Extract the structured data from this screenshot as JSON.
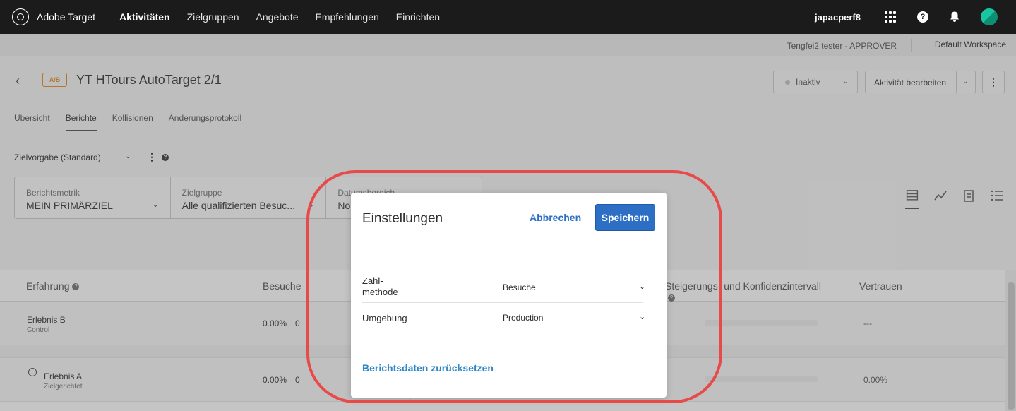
{
  "app": {
    "brand": "Adobe Target",
    "nav": [
      "Aktivitäten",
      "Zielgruppen",
      "Angebote",
      "Empfehlungen",
      "Einrichten"
    ],
    "active_nav": "Aktivitäten",
    "user": "japacperf8"
  },
  "subheader": {
    "approver": "Tengfei2 tester - APPROVER",
    "workspace": "Default Workspace"
  },
  "activity": {
    "type_badge": "A/B",
    "title": "YT HTours AutoTarget 2/1",
    "status": "Inaktiv",
    "edit_label": "Aktivität bearbeiten"
  },
  "tabs": [
    "Übersicht",
    "Berichte",
    "Kollisionen",
    "Änderungsprotokoll"
  ],
  "active_tab": "Berichte",
  "goal": {
    "label": "Zielvorgabe (Standard)"
  },
  "filters": [
    {
      "label": "Berichtsmetrik",
      "value": "MEIN PRIMÄRZIEL"
    },
    {
      "label": "Zielgruppe",
      "value": "Alle qualifizierten Besuc..."
    },
    {
      "label": "Datumsbereich",
      "value": "No"
    }
  ],
  "table": {
    "headers": [
      "Erfahrung",
      "Besuche",
      "",
      "",
      "Steigerungs- und Konfidenzintervall",
      "Vertrauen"
    ],
    "rows": [
      {
        "name": "Erlebnis B",
        "sub": "Control",
        "pct": "0.00%",
        "count": "0",
        "confidence": "---"
      },
      {
        "name": "Erlebnis A",
        "sub": "Zielgerichtet",
        "pct": "0.00%",
        "count": "0",
        "confidence": "0.00%"
      }
    ]
  },
  "modal": {
    "title": "Einstellungen",
    "cancel": "Abbrechen",
    "save": "Speichern",
    "fields": [
      {
        "label_line1": "Zähl-",
        "label_line2": "methode",
        "value": "Besuche"
      },
      {
        "label_line1": "Umgebung",
        "label_line2": "",
        "value": "Production"
      }
    ],
    "reset": "Berichtsdaten zurücksetzen"
  },
  "colors": {
    "accent": "#2d6fc5",
    "highlight": "#e84a4a",
    "badge": "#e68619",
    "nav_bg": "#1b1b1b"
  }
}
